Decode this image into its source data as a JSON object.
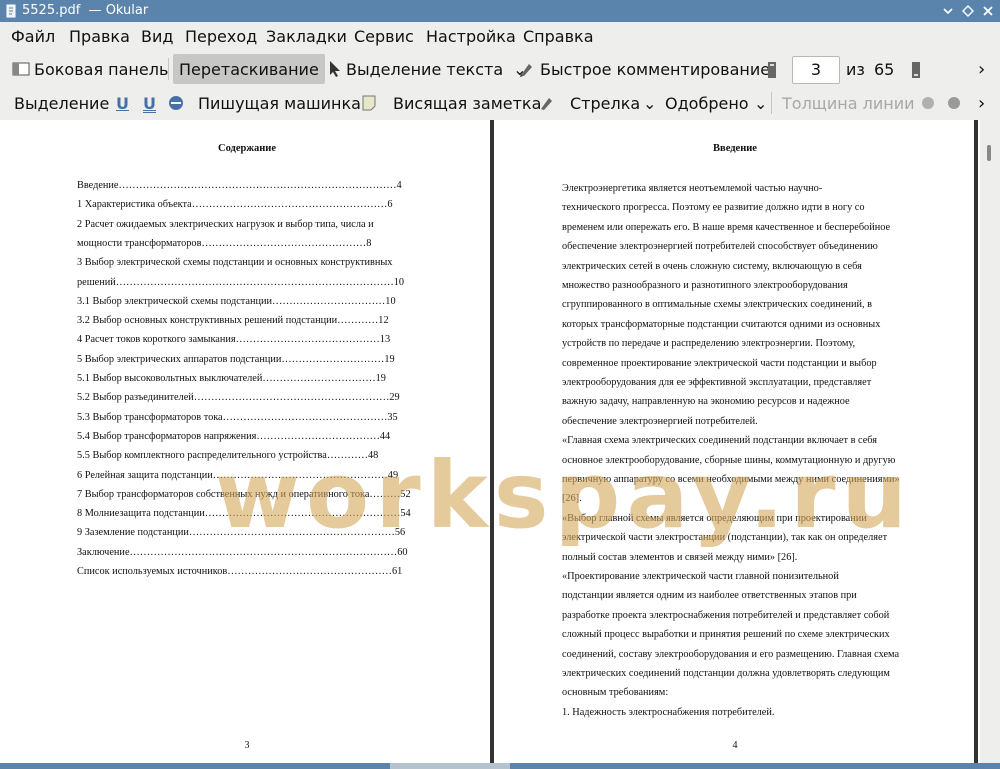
{
  "window": {
    "title": "5525.pdf  — Okular"
  },
  "menu": [
    "Файл",
    "Правка",
    "Вид",
    "Переход",
    "Закладки",
    "Сервис",
    "Настройка",
    "Справка"
  ],
  "toolbar1": {
    "sidebar": "Боковая панель",
    "drag": "Перетаскивание",
    "text_select": "Выделение текста",
    "quick_annot": "Быстрое комментирование",
    "page_current": "3",
    "page_of": "из",
    "page_total": "65"
  },
  "toolbar2": {
    "selection": "Выделение",
    "typewriter": "Пишущая машинка",
    "note": "Висящая заметка",
    "arrow": "Стрелка",
    "approved": "Одобрено",
    "line_width": "Толщина линии"
  },
  "left_page": {
    "heading": "Содержание",
    "toc": [
      "Введение………………………………………………………………………4",
      "1 Характеристика объекта…………………………………………………6",
      "2 Расчет ожидаемых электрических нагрузок и выбор типа, числа и",
      "   мощности трансформаторов…………………………………………8",
      "3 Выбор электрической схемы подстанции и основных конструктивных",
      "   решений………………………………………………………………………10",
      "   3.1 Выбор электрической схемы подстанции……………………………10",
      "   3.2 Выбор основных конструктивных решений подстанции…………12",
      "4 Расчет токов короткого замыкания……………………………………13",
      "5 Выбор электрических аппаратов подстанции…………………………19",
      "   5.1 Выбор высоковольтных выключателей……………………………19",
      "   5.2 Выбор разъединителей…………………………………………………29",
      "   5.3 Выбор трансформаторов тока…………………………………………35",
      "   5.4 Выбор трансформаторов напряжения………………………………44",
      "   5.5 Выбор комплектного распределительного устройства…………48",
      "6 Релейная защита подстанции……………………………………………49",
      "7 Выбор трансформаторов собственных нужд и оперативного тока………52",
      "8 Молниезащита подстанции…………………………………………………54",
      "9 Заземление подстанции……………………………………………………56",
      "Заключение……………………………………………………………………60",
      "Список используемых источников…………………………………………61"
    ],
    "page_number": "3"
  },
  "right_page": {
    "heading": "Введение",
    "lines": [
      "        Электроэнергетика     является     неотъемлемой     частью     научно-",
      "технического прогресса. Поэтому ее развитие должно идти в ногу со",
      "временем или опережать его. В наше время качественное и бесперебойное",
      "обеспечение электроэнергией потребителей способствует объединению",
      "электрических сетей в очень сложную систему, включающую в себя",
      "множество      разнообразного      и      разнотипного      электрооборудования",
      "сгруппированного в оптимальные схемы электрических соединений, в",
      "которых трансформаторные подстанции считаются одними из основных",
      "устройств   по   передаче   и   распределению   электроэнергии.   Поэтому,",
      "современное проектирование электрической части подстанции и выбор",
      "электрооборудования для ее эффективной эксплуатации, представляет",
      "важную   задачу,   направленную   на   экономию   ресурсов   и   надежное",
      "обеспечение электроэнергией потребителей.",
      "        «Главная схема электрических соединений подстанции включает в себя",
      "основное электрооборудование, сборные шины, коммутационную и другую",
      "первичную аппаратуру со всеми необходимыми между ними соединениями»",
      "[26].",
      "        «Выбор главной схемы является определяющим при проектировании",
      "электрической части электростанции (подстанции), так как он определяет",
      "полный состав элементов и связей между ними» [26].",
      "        «Проектирование   электрической   части   главной   понизительной",
      "подстанции является одним из наиболее ответственных этапов при",
      "разработке проекта электроснабжения потребителей и представляет собой",
      "сложный процесс выработки и принятия решений по схеме электрических",
      "соединений, составу электрооборудования и его размещению. Главная схема",
      "электрических соединений подстанции должна удовлетворять следующим",
      "основным требованиям:",
      "        1. Надежность электроснабжения потребителей."
    ],
    "page_number": "4"
  },
  "watermark": "workspay.ru"
}
